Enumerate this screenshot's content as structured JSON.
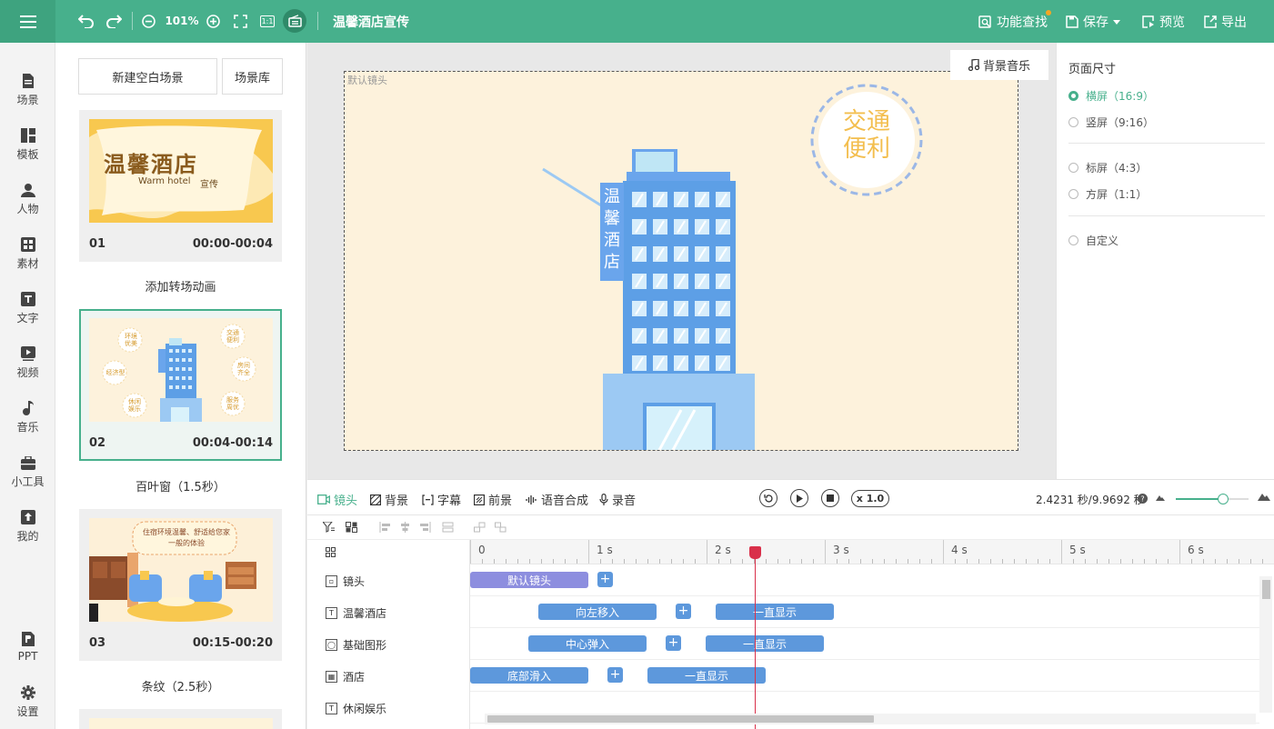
{
  "header": {
    "zoom": "101%",
    "ratio_icon_label": "1:1",
    "title": "温馨酒店宣传",
    "feature_search": "功能查找",
    "save": "保存",
    "preview": "预览",
    "export": "导出"
  },
  "nav": {
    "items": [
      {
        "label": "场景",
        "icon": "scene-icon"
      },
      {
        "label": "模板",
        "icon": "template-icon"
      },
      {
        "label": "人物",
        "icon": "person-icon"
      },
      {
        "label": "素材",
        "icon": "material-icon"
      },
      {
        "label": "文字",
        "icon": "text-icon"
      },
      {
        "label": "视频",
        "icon": "video-icon"
      },
      {
        "label": "音乐",
        "icon": "music-icon"
      },
      {
        "label": "小工具",
        "icon": "toolbox-icon"
      },
      {
        "label": "我的",
        "icon": "upload-icon"
      }
    ],
    "bottom": [
      {
        "label": "PPT",
        "icon": "ppt-icon"
      },
      {
        "label": "设置",
        "icon": "settings-icon"
      }
    ]
  },
  "scenes": {
    "new_blank": "新建空白场景",
    "library": "场景库",
    "cards": [
      {
        "num": "01",
        "time": "00:00-00:04",
        "transition": "添加转场动画"
      },
      {
        "num": "02",
        "time": "00:04-00:14",
        "transition": "百叶窗（1.5秒）"
      },
      {
        "num": "03",
        "time": "00:15-00:20",
        "transition": "条纹（2.5秒）"
      }
    ],
    "thumb1": {
      "title": "温馨酒店",
      "subtitle": "Warm hotel",
      "tag": "宣传"
    },
    "thumb2": {
      "bubbles": [
        "环境优美",
        "交通便利",
        "经济型",
        "房间齐全",
        "休闲娱乐",
        "服务周优"
      ]
    },
    "thumb3": {
      "speech": "住宿环境温馨、舒适给您家一般的体验"
    }
  },
  "canvas": {
    "bgm": "背景音乐",
    "lens_label": "默认镜头",
    "badge": "交通便利",
    "sign": "温馨酒店"
  },
  "page_size": {
    "title": "页面尺寸",
    "options": [
      {
        "label": "横屏（16:9）",
        "selected": true
      },
      {
        "label": "竖屏（9:16）",
        "selected": false
      },
      {
        "label": "标屏（4:3）",
        "selected": false
      },
      {
        "label": "方屏（1:1）",
        "selected": false
      },
      {
        "label": "自定义",
        "selected": false
      }
    ]
  },
  "timeline": {
    "tabs": [
      "镜头",
      "背景",
      "字幕",
      "前景",
      "语音合成",
      "录音"
    ],
    "speed": "x 1.0",
    "time_info": "2.4231 秒/9.9692 秒",
    "current_seconds": 2.4231,
    "total_seconds": 9.9692,
    "zoom_fraction": 0.65,
    "ruler": [
      "0",
      "1 s",
      "2 s",
      "3 s",
      "4 s",
      "5 s",
      "6 s"
    ],
    "lanes": [
      {
        "name": "镜头",
        "icon": "camera-lane-icon",
        "clips": [
          {
            "label": "默认镜头"
          }
        ]
      },
      {
        "name": "温馨酒店",
        "icon": "text-lane-icon",
        "clips": [
          {
            "label": "向左移入"
          },
          {
            "label": "一直显示"
          }
        ]
      },
      {
        "name": "基础图形",
        "icon": "shape-lane-icon",
        "clips": [
          {
            "label": "中心弹入"
          },
          {
            "label": "一直显示"
          }
        ]
      },
      {
        "name": "酒店",
        "icon": "image-lane-icon",
        "clips": [
          {
            "label": "底部滑入"
          },
          {
            "label": "一直显示"
          }
        ]
      },
      {
        "name": "休闲娱乐",
        "icon": "text-lane-icon",
        "clips": []
      }
    ]
  },
  "colors": {
    "accent": "#47b08c",
    "clip": "#5d98dc",
    "lens_clip": "#8d8edf",
    "playhead": "#d9304a"
  }
}
